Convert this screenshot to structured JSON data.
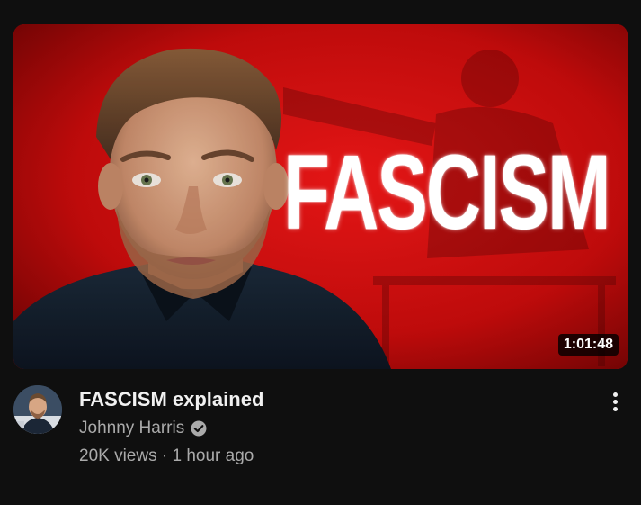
{
  "video": {
    "thumbnail_text": "FASCISM",
    "duration": "1:01:48",
    "title": "FASCISM explained",
    "channel": "Johnny Harris",
    "views": "20K views",
    "separator": "·",
    "age": "1 hour ago"
  },
  "icons": {
    "verified": "verified-check-icon",
    "more": "vertical-ellipsis-icon"
  },
  "colors": {
    "background": "#0f0f0f",
    "thumbnail_red": "#d10f0f",
    "primary_text": "#f1f1f1",
    "secondary_text": "#aaaaaa"
  }
}
